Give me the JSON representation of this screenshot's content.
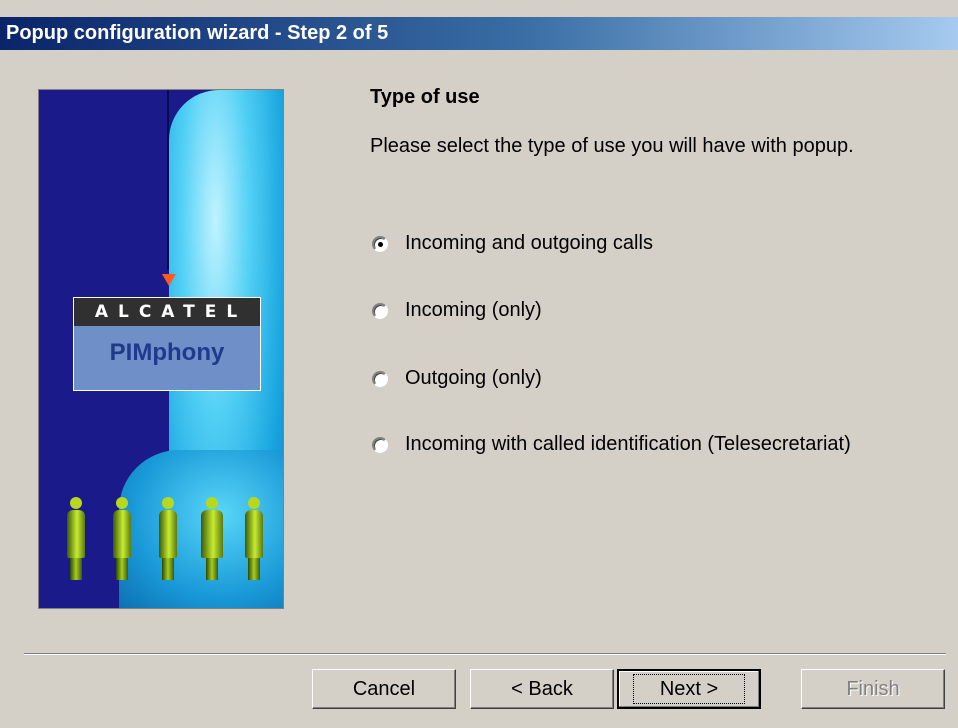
{
  "window": {
    "title": "Popup configuration wizard - Step 2 of 5"
  },
  "banner": {
    "brand": "ALCATEL",
    "product": "PIMphony"
  },
  "content": {
    "heading": "Type of use",
    "description": "Please select the type of use you will have with popup.",
    "options": [
      {
        "label": "Incoming and outgoing calls",
        "selected": true
      },
      {
        "label": "Incoming (only)",
        "selected": false
      },
      {
        "label": "Outgoing (only)",
        "selected": false
      },
      {
        "label": "Incoming with called identification (Telesecretariat)",
        "selected": false
      }
    ]
  },
  "buttons": {
    "cancel": "Cancel",
    "back": "< Back",
    "next": "Next >",
    "finish": "Finish"
  }
}
